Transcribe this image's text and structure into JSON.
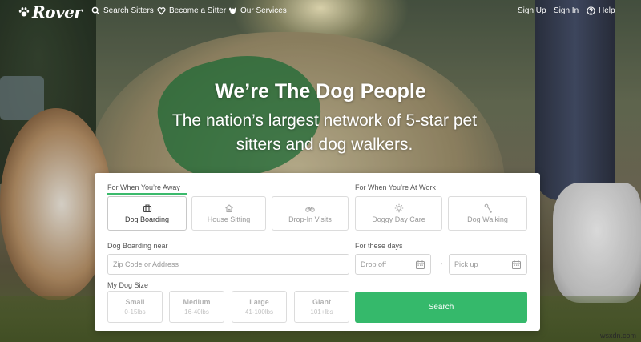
{
  "brand": {
    "name": "Rover",
    "icon": "paw-icon",
    "accent": "#35b96b"
  },
  "nav": {
    "search_sitters": {
      "label": "Search Sitters",
      "icon": "search-icon"
    },
    "become_sitter": {
      "label": "Become a Sitter",
      "icon": "heart-icon"
    },
    "our_services": {
      "label": "Our Services",
      "icon": "dog-icon"
    },
    "sign_up": "Sign Up",
    "sign_in": "Sign In",
    "help": {
      "label": "Help",
      "icon": "question-circle-icon"
    }
  },
  "hero": {
    "headline": "We’re The Dog People",
    "subhead": "The nation’s largest network of 5-star pet sitters and dog walkers."
  },
  "search_card": {
    "away_label": "For When You’re Away",
    "work_label": "For When You’re At Work",
    "services": [
      {
        "label": "Dog Boarding",
        "icon": "luggage-icon",
        "selected": true
      },
      {
        "label": "House Sitting",
        "icon": "house-icon",
        "selected": false
      },
      {
        "label": "Drop-In Visits",
        "icon": "bicycle-icon",
        "selected": false
      },
      {
        "label": "Doggy Day Care",
        "icon": "sun-icon",
        "selected": false
      },
      {
        "label": "Dog Walking",
        "icon": "leash-icon",
        "selected": false
      }
    ],
    "location_label": "Dog Boarding near",
    "location_placeholder": "Zip Code or Address",
    "dates_label": "For these days",
    "drop_off_placeholder": "Drop off",
    "pick_up_placeholder": "Pick up",
    "date_separator": "→",
    "size_label": "My Dog Size",
    "sizes": [
      {
        "name": "Small",
        "range": "0-15lbs"
      },
      {
        "name": "Medium",
        "range": "16-40lbs"
      },
      {
        "name": "Large",
        "range": "41-100lbs"
      },
      {
        "name": "Giant",
        "range": "101+lbs"
      }
    ],
    "search_button": "Search"
  },
  "watermark": "wsxdn.com"
}
